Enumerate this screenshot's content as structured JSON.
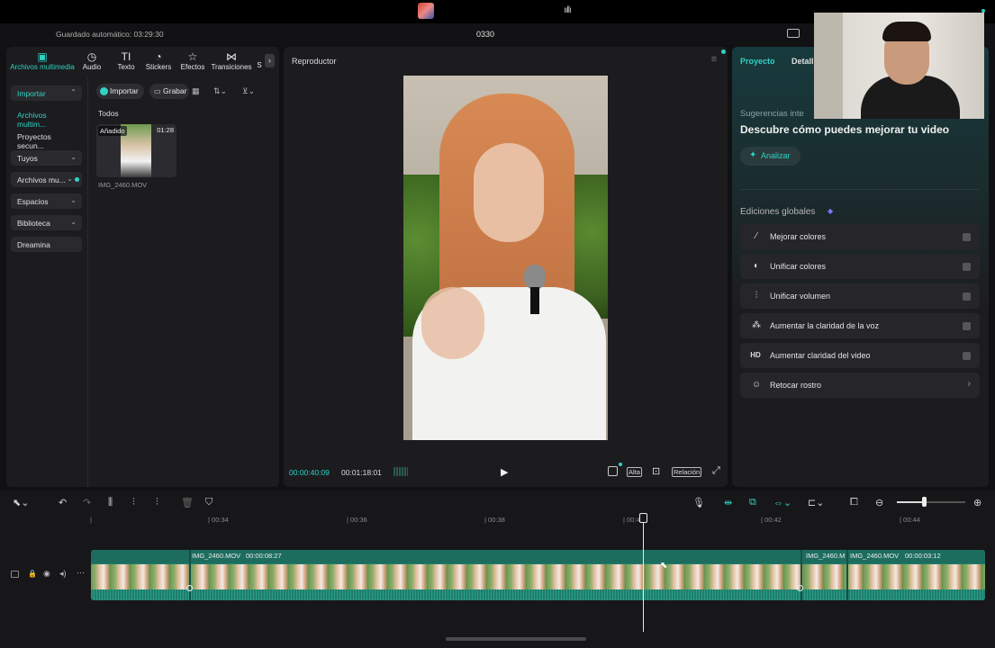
{
  "titlebar": {
    "project_name": "0330",
    "autosave": "Guardado automático: 03:29:30"
  },
  "media_panel": {
    "tabs": [
      {
        "label": "Archivos multimedia",
        "icon": "media-icon"
      },
      {
        "label": "Audio",
        "icon": "audio-icon"
      },
      {
        "label": "Texto",
        "icon": "text-icon"
      },
      {
        "label": "Stickers",
        "icon": "stickers-icon"
      },
      {
        "label": "Efectos",
        "icon": "effects-icon"
      },
      {
        "label": "Transiciones",
        "icon": "transitions-icon"
      },
      {
        "label": "S",
        "icon": ""
      }
    ],
    "sidebar": [
      {
        "label": "Importar"
      },
      {
        "label": "Archivos multim..."
      },
      {
        "label": "Proyectos secun..."
      },
      {
        "label": "Tuyos"
      },
      {
        "label": "Archivos mu..."
      },
      {
        "label": "Espacios"
      },
      {
        "label": "Biblioteca"
      },
      {
        "label": "Dreamina"
      }
    ],
    "import_button": "Importar",
    "record_button": "Grabar",
    "section_label": "Todos",
    "clip": {
      "badge": "Añadido",
      "duration": "01:28",
      "name": "IMG_2460.MOV"
    }
  },
  "player": {
    "title": "Reproductor",
    "current_time": "00:00:40:09",
    "total_time": "00:01:18:01",
    "quality_button": "Alta",
    "ratio_button": "Relación"
  },
  "right_panel": {
    "tabs": [
      "Proyecto",
      "Detall"
    ],
    "suggestions_label": "Sugerencias inte",
    "suggestions_title": "Descubre cómo puedes mejorar tu video",
    "analyze_button": "Analizar",
    "global_edits_label": "Ediciones globales",
    "edits": [
      {
        "label": "Mejorar colores",
        "icon": "magic-wand-icon"
      },
      {
        "label": "Unificar colores",
        "icon": "color-icon"
      },
      {
        "label": "Unificar volumen",
        "icon": "sliders-icon"
      },
      {
        "label": "Aumentar la claridad de la voz",
        "icon": "voice-icon"
      },
      {
        "label": "Aumentar claridad del video",
        "icon": "hd-icon"
      },
      {
        "label": "Retocar rostro",
        "icon": "face-icon"
      }
    ]
  },
  "timeline": {
    "ruler": [
      "|",
      "| 00:34",
      "| 00:36",
      "| 00:38",
      "| 00:4",
      "| 00:42",
      "| 00:44"
    ],
    "clip_a_name": "IMG_2460.MOV",
    "clip_a_duration": "00:00:08:27",
    "clip_b_name": "IMG_2460.M",
    "clip_c_name": "IMG_2460.MOV",
    "clip_c_duration": "00:00:03:12"
  },
  "colors": {
    "accent": "#2fd3c4",
    "track": "#1f7e6d"
  }
}
